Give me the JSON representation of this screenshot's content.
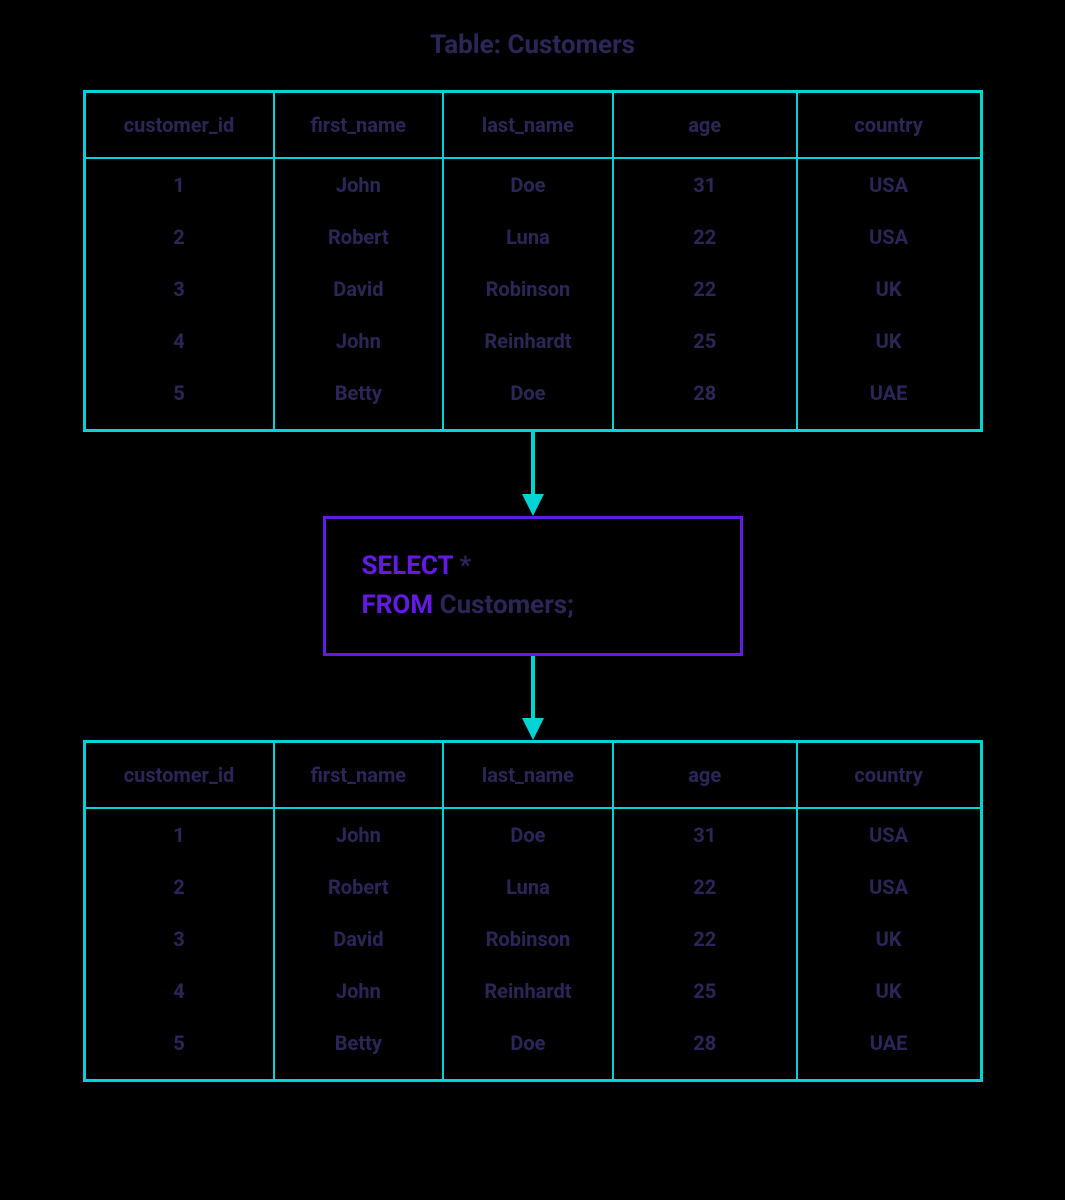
{
  "title": "Table: Customers",
  "columns": [
    "customer_id",
    "first_name",
    "last_name",
    "age",
    "country"
  ],
  "source_rows": [
    {
      "customer_id": "1",
      "first_name": "John",
      "last_name": "Doe",
      "age": "31",
      "country": "USA"
    },
    {
      "customer_id": "2",
      "first_name": "Robert",
      "last_name": "Luna",
      "age": "22",
      "country": "USA"
    },
    {
      "customer_id": "3",
      "first_name": "David",
      "last_name": "Robinson",
      "age": "22",
      "country": "UK"
    },
    {
      "customer_id": "4",
      "first_name": "John",
      "last_name": "Reinhardt",
      "age": "25",
      "country": "UK"
    },
    {
      "customer_id": "5",
      "first_name": "Betty",
      "last_name": "Doe",
      "age": "28",
      "country": "UAE"
    }
  ],
  "query": {
    "kw1": "SELECT",
    "rest1": " *",
    "kw2": "FROM",
    "rest2": " Customers;"
  },
  "result_rows": [
    {
      "customer_id": "1",
      "first_name": "John",
      "last_name": "Doe",
      "age": "31",
      "country": "USA"
    },
    {
      "customer_id": "2",
      "first_name": "Robert",
      "last_name": "Luna",
      "age": "22",
      "country": "USA"
    },
    {
      "customer_id": "3",
      "first_name": "David",
      "last_name": "Robinson",
      "age": "22",
      "country": "UK"
    },
    {
      "customer_id": "4",
      "first_name": "John",
      "last_name": "Reinhardt",
      "age": "25",
      "country": "UK"
    },
    {
      "customer_id": "5",
      "first_name": "Betty",
      "last_name": "Doe",
      "age": "28",
      "country": "UAE"
    }
  ],
  "colors": {
    "border_cyan": "#00d4d4",
    "border_purple": "#6419e6",
    "text": "#2b2657",
    "bg": "#000000"
  }
}
